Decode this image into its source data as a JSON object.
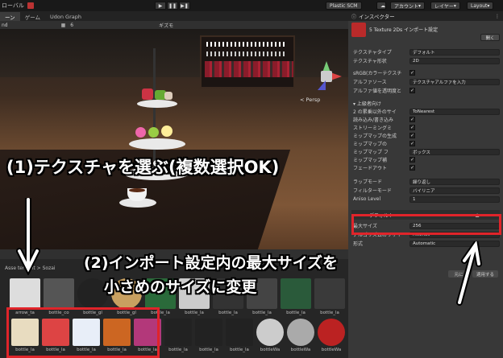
{
  "topbar": {
    "left_label": "ローバル",
    "plastic": "Plastic SCM",
    "account": "アカウント",
    "layer": "レイヤー",
    "layout": "Layout"
  },
  "tabs": [
    "ーン",
    "ゲーム",
    "Udon Graph"
  ],
  "scene_toolbar": {
    "left": "nd",
    "zoom": "6",
    "gizmo": "ギズモ"
  },
  "scene": {
    "persp_label": "< Persp"
  },
  "project": {
    "breadcrumb": "Asse    terlight > Sozai",
    "row1": [
      "arrow_ta",
      "bottle_co",
      "bottle_gl",
      "bottle_gl",
      "bottle_la",
      "bottle_la",
      "bottle_la",
      "bottle_la",
      "bottle_la",
      "bottle_la"
    ],
    "row2": [
      "bottle_la",
      "bottle_la",
      "bottle_la",
      "bottle_la",
      "bottle_la",
      "bottle_la",
      "bottle_la",
      "bottle_la",
      "bottleWa",
      "bottleWa",
      "bottleWa"
    ]
  },
  "inspector": {
    "tab": "インスペクター",
    "title": "5 Texture 2Ds インポート設定",
    "open_button": "開く",
    "rows": [
      {
        "label": "テクスチャタイプ",
        "value": "デフォルト"
      },
      {
        "label": "テクスチャ形状",
        "value": "2D"
      },
      {
        "label": "sRGB(カラーテクスチ",
        "value": ""
      },
      {
        "label": "アルファソース",
        "value": "テクスチャアルファを入力"
      },
      {
        "label": "アルファ値を透明度と",
        "value": ""
      },
      {
        "label": "▾ 上級者向け",
        "value": ""
      },
      {
        "label": "2 の累乗以外のサイ",
        "value": "ToNearest"
      },
      {
        "label": "読み込み/書き込み",
        "value": ""
      },
      {
        "label": "ストリーミングミ",
        "value": ""
      },
      {
        "label": "ミップマップの生成",
        "value": ""
      },
      {
        "label": "ミップマップの",
        "value": ""
      },
      {
        "label": "ミップマップ フ",
        "value": "ボックス"
      },
      {
        "label": "ミップマップ補",
        "value": ""
      },
      {
        "label": "フェードアウト",
        "value": ""
      },
      {
        "label": "ラップモード",
        "value": "繰り返し"
      },
      {
        "label": "フィルターモード",
        "value": "バイリニア"
      },
      {
        "label": "Aniso Level",
        "value": "1"
      }
    ],
    "platform_tab": "デフォルト",
    "max_size_label": "最大サイズ",
    "max_size_value": "256",
    "algo_label": "アルゴリズムのリサイ",
    "algo_value": "Mitchell",
    "format_label": "形式",
    "format_value": "Automatic",
    "revert": "元に",
    "apply": "適用する"
  },
  "callouts": {
    "step1": "(1)テクスチャを選ぶ(複数選択OK)",
    "step2_line1": "(2)インポート設定内の最大サイズを",
    "step2_line2": "小さめのサイズに変更"
  },
  "colors": {
    "highlight": "#e0242a",
    "inspector_bg": "#383838"
  }
}
